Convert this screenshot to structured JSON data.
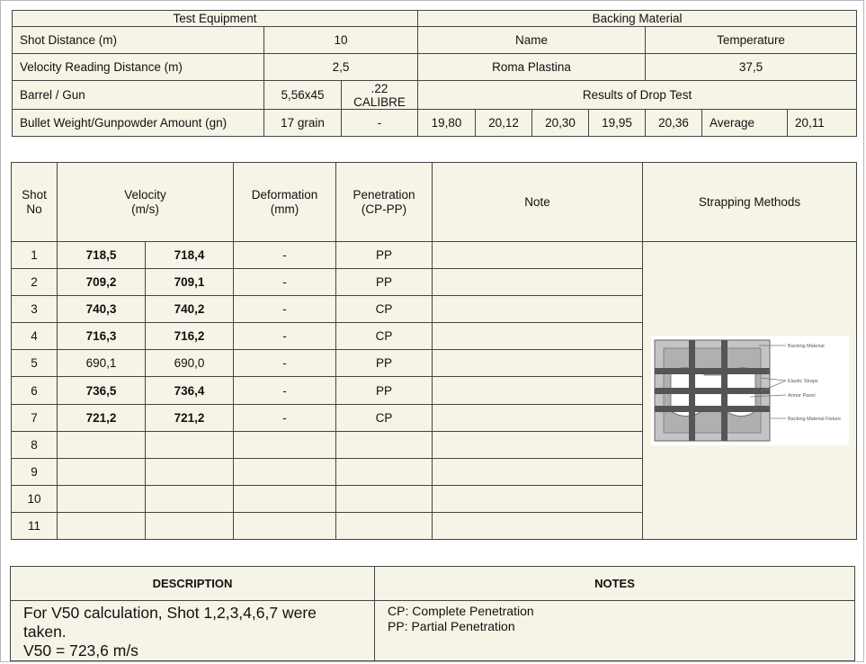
{
  "equipment": {
    "test_equipment_label": "Test Equipment",
    "backing_material_label": "Backing Material",
    "shot_distance_label": "Shot Distance (m)",
    "shot_distance_value": "10",
    "name_label": "Name",
    "temperature_label": "Temperature",
    "velocity_distance_label": "Velocity Reading Distance (m)",
    "velocity_distance_value": "2,5",
    "name_value": "Roma Plastina",
    "temperature_value": "37,5",
    "barrel_label": "Barrel / Gun",
    "barrel_value": "5,56x45",
    "calibre_line1": ".22",
    "calibre_line2": "CALIBRE",
    "drop_test_label": "Results of Drop Test",
    "bullet_label": "Bullet Weight/Gunpowder Amount (gn)",
    "bullet_value": "17 grain",
    "gunpowder_value": "-",
    "drop_values": [
      "19,80",
      "20,12",
      "20,30",
      "19,95",
      "20,36"
    ],
    "average_label": "Average",
    "average_value": "20,11"
  },
  "shots": {
    "headers": {
      "shot_line1": "Shot",
      "shot_line2": "No",
      "velocity_line1": "Velocity",
      "velocity_line2": "(m/s)",
      "deformation_line1": "Deformation",
      "deformation_line2": "(mm)",
      "penetration_line1": "Penetration",
      "penetration_line2": "(CP-PP)",
      "note": "Note",
      "strapping": "Strapping Methods"
    },
    "rows": [
      {
        "no": "1",
        "v1": "718,5",
        "v2": "718,4",
        "def": "-",
        "pen": "PP",
        "note": ""
      },
      {
        "no": "2",
        "v1": "709,2",
        "v2": "709,1",
        "def": "-",
        "pen": "PP",
        "note": ""
      },
      {
        "no": "3",
        "v1": "740,3",
        "v2": "740,2",
        "def": "-",
        "pen": "CP",
        "note": ""
      },
      {
        "no": "4",
        "v1": "716,3",
        "v2": "716,2",
        "def": "-",
        "pen": "CP",
        "note": ""
      },
      {
        "no": "5",
        "v1": "690,1",
        "v2": "690,0",
        "def": "-",
        "pen": "PP",
        "note": ""
      },
      {
        "no": "6",
        "v1": "736,5",
        "v2": "736,4",
        "def": "-",
        "pen": "PP",
        "note": ""
      },
      {
        "no": "7",
        "v1": "721,2",
        "v2": "721,2",
        "def": "-",
        "pen": "CP",
        "note": ""
      },
      {
        "no": "8",
        "v1": "",
        "v2": "",
        "def": "",
        "pen": "",
        "note": ""
      },
      {
        "no": "9",
        "v1": "",
        "v2": "",
        "def": "",
        "pen": "",
        "note": ""
      },
      {
        "no": "10",
        "v1": "",
        "v2": "",
        "def": "",
        "pen": "",
        "note": ""
      },
      {
        "no": "11",
        "v1": "",
        "v2": "",
        "def": "",
        "pen": "",
        "note": ""
      }
    ],
    "bold_rows": [
      0,
      1,
      2,
      3,
      5,
      6
    ],
    "diagram_labels": [
      "Backing Material",
      "Elastic Straps",
      "Armor Panel",
      "Backing Material Fixture"
    ]
  },
  "summary": {
    "description_header": "DESCRIPTION",
    "notes_header": "NOTES",
    "description_line1": "For V50 calculation, Shot 1,2,3,4,6,7 were",
    "description_line2": "taken.",
    "description_line3": "V50 = 723,6 m/s",
    "notes_line1": "CP: Complete Penetration",
    "notes_line2": "PP: Partial Penetration"
  }
}
